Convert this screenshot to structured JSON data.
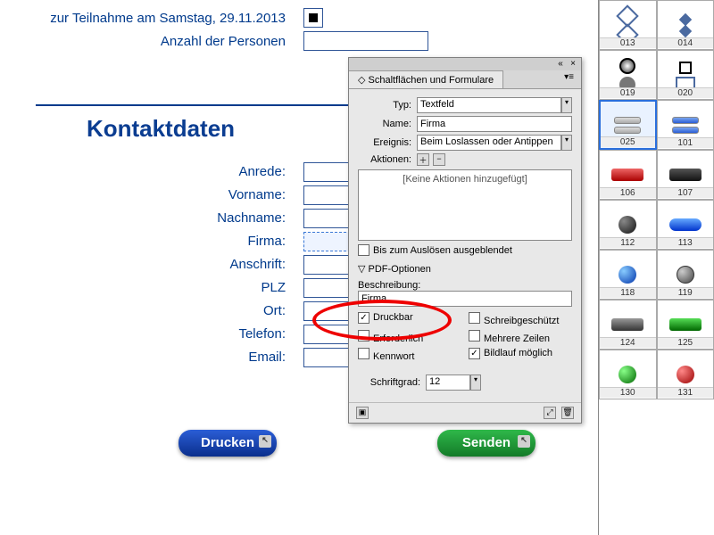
{
  "form": {
    "samstag_label": "zur Teilnahme am Samstag, 29.11.2013",
    "personen_label": "Anzahl der Personen",
    "heading": "Kontaktdaten",
    "fields": {
      "anrede": "Anrede:",
      "vorname": "Vorname:",
      "nachname": "Nachname:",
      "firma": "Firma:",
      "anschrift": "Anschrift:",
      "plz": "PLZ",
      "ort": "Ort:",
      "telefon": "Telefon:",
      "email": "Email:"
    },
    "buttons": {
      "print": "Drucken",
      "send": "Senden"
    }
  },
  "panel": {
    "title": "Schaltflächen und Formulare",
    "typ_label": "Typ:",
    "typ_value": "Textfeld",
    "name_label": "Name:",
    "name_value": "Firma",
    "ereignis_label": "Ereignis:",
    "ereignis_value": "Beim Loslassen oder Antippen",
    "aktionen_label": "Aktionen:",
    "no_actions": "[Keine Aktionen hinzugefügt]",
    "bis_ausloesen": "Bis zum Auslösen ausgeblendet",
    "pdf_optionen": "PDF-Optionen",
    "beschreibung_label": "Beschreibung:",
    "beschreibung_value": "Firma",
    "cb": {
      "druckbar": "Druckbar",
      "erforderlich": "Erforderlich",
      "kennwort": "Kennwort",
      "schreibgeschuetzt": "Schreibgeschützt",
      "mehrere_zeilen": "Mehrere Zeilen",
      "bildlauf": "Bildlauf möglich"
    },
    "schriftgrad_label": "Schriftgrad:",
    "schriftgrad_value": "12"
  },
  "library": [
    {
      "id": "013"
    },
    {
      "id": "014"
    },
    {
      "id": "019"
    },
    {
      "id": "020"
    },
    {
      "id": "025",
      "selected": true
    },
    {
      "id": "101"
    },
    {
      "id": "106"
    },
    {
      "id": "107"
    },
    {
      "id": "112"
    },
    {
      "id": "113"
    },
    {
      "id": "118"
    },
    {
      "id": "119"
    },
    {
      "id": "124"
    },
    {
      "id": "125"
    },
    {
      "id": "130"
    },
    {
      "id": "131"
    }
  ]
}
